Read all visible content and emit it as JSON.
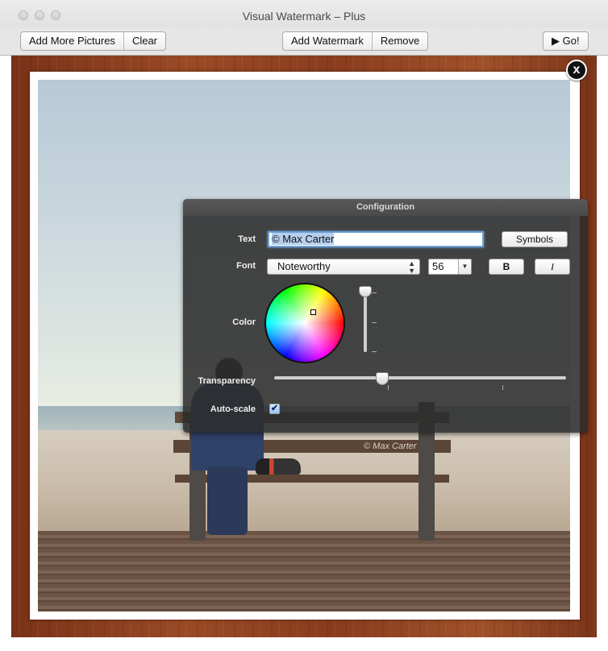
{
  "window": {
    "title": "Visual Watermark – Plus"
  },
  "toolbar": {
    "add_more_pictures": "Add More Pictures",
    "clear": "Clear",
    "add_watermark": "Add Watermark",
    "remove": "Remove",
    "go": "▶ Go!"
  },
  "photo": {
    "watermark_on_bench": "© Max Carter",
    "close_glyph": "x"
  },
  "config": {
    "title": "Configuration",
    "text_label": "Text",
    "text_value": "© Max Carter",
    "symbols_button": "Symbols",
    "font_label": "Font",
    "font_value": "Noteworthy",
    "font_size": "56",
    "bold_button": "B",
    "italic_button": "I",
    "color_label": "Color",
    "transparency_label": "Transparency",
    "transparency_level": 0.37,
    "brightness_level": 1.0,
    "autoscale_label": "Auto-scale",
    "autoscale_checked": true,
    "check_glyph": "✔"
  }
}
